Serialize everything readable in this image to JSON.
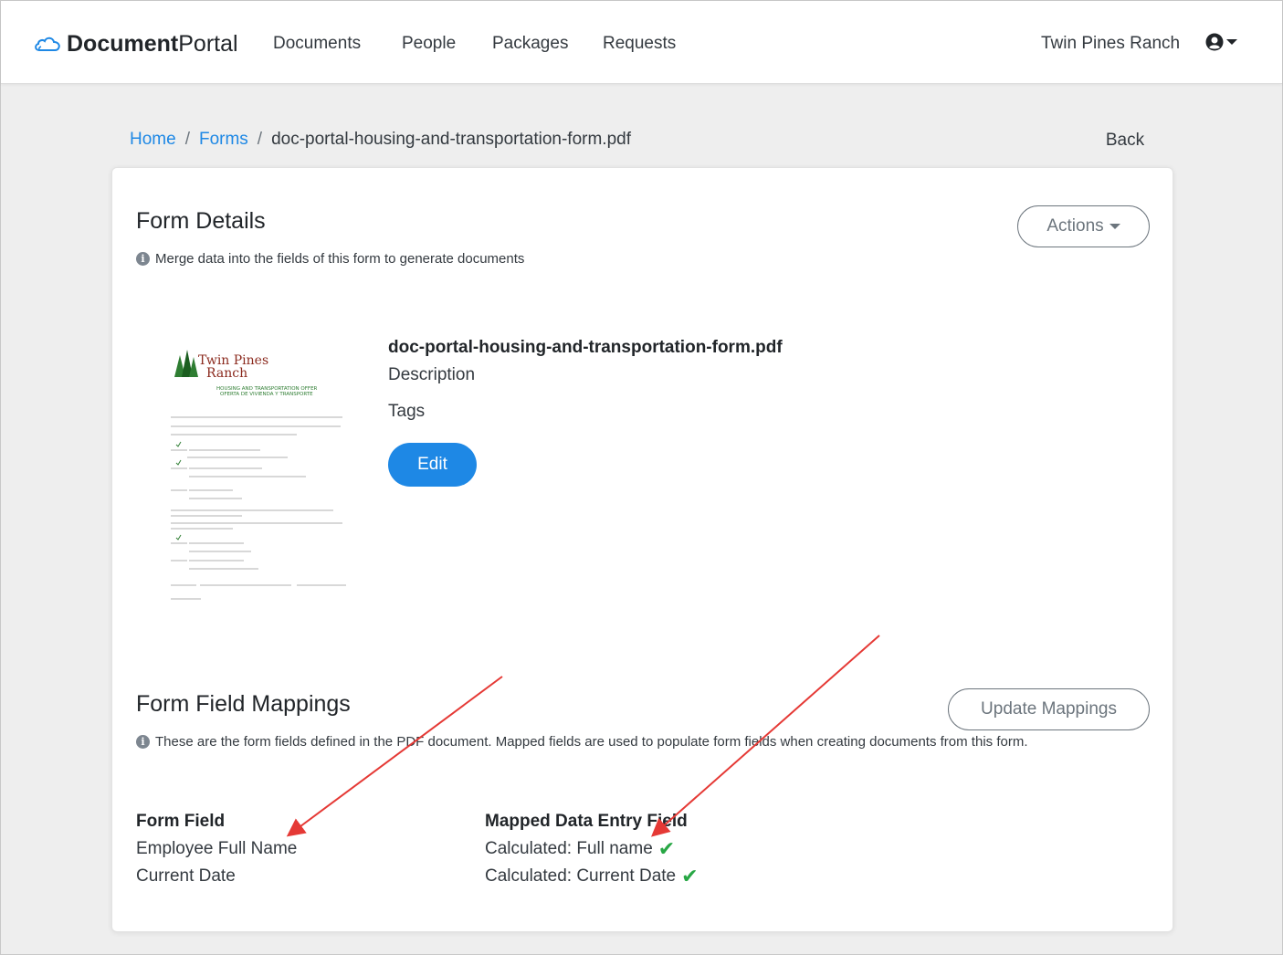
{
  "brand": {
    "name_bold": "Document",
    "name_light": "Portal",
    "icon": "cloud-icon"
  },
  "nav": {
    "items": [
      "Documents",
      "People",
      "Packages",
      "Requests"
    ],
    "org_name": "Twin Pines Ranch",
    "user_icon": "user-circle-icon"
  },
  "breadcrumb": {
    "home": "Home",
    "forms": "Forms",
    "current": "doc-portal-housing-and-transportation-form.pdf",
    "separator": "/"
  },
  "back_label": "Back",
  "form_details": {
    "title": "Form Details",
    "hint": "Merge data into the fields of this form to generate documents",
    "actions_label": "Actions",
    "file_name": "doc-portal-housing-and-transportation-form.pdf",
    "description_label": "Description",
    "tags_label": "Tags",
    "edit_label": "Edit"
  },
  "thumbnail": {
    "logo_line1": "Twin Pines",
    "logo_line2": "Ranch",
    "heading1": "HOUSING AND TRANSPORTATION OFFER",
    "heading2": "OFERTA DE VIVIENDA Y TRANSPORTE"
  },
  "mappings": {
    "title": "Form Field Mappings",
    "hint": "These are the form fields defined in the PDF document. Mapped fields are used to populate form fields when creating documents from this form.",
    "update_label": "Update Mappings",
    "col_form_field": "Form Field",
    "col_mapped": "Mapped Data Entry Field",
    "rows": [
      {
        "form_field": "Employee Full Name",
        "mapped": "Calculated: Full name",
        "status": "mapped"
      },
      {
        "form_field": "Current Date",
        "mapped": "Calculated: Current Date",
        "status": "mapped"
      }
    ]
  },
  "colors": {
    "primary": "#1e88e5",
    "success": "#28a745",
    "annotation": "#e53935",
    "logo_green": "#2e7d32",
    "logo_brown": "#8b2a1e"
  }
}
